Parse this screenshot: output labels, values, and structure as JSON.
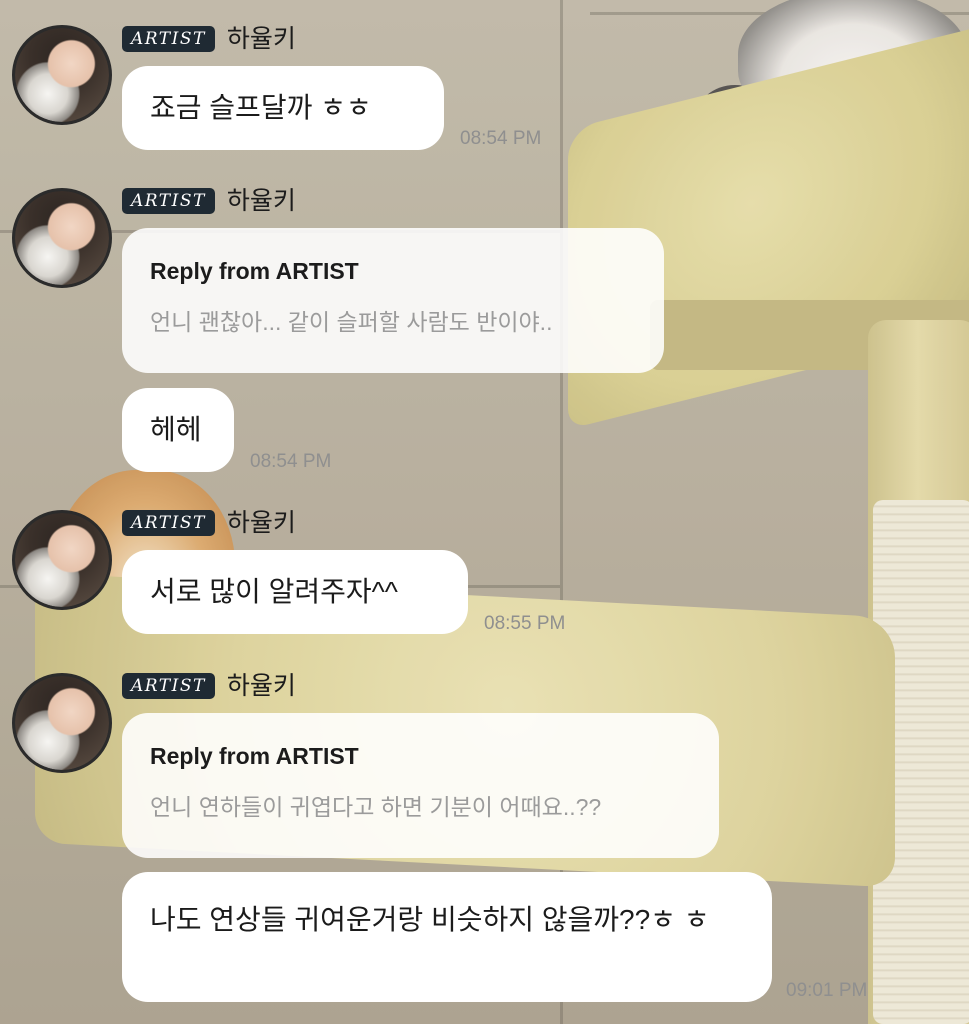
{
  "sender": {
    "badge": "ARTIST",
    "name": "하율키"
  },
  "messages": [
    {
      "kind": "text",
      "text": "죠금 슬프달까 ㅎㅎ",
      "time": "08:54 PM",
      "with_header": true
    },
    {
      "kind": "reply",
      "reply_label": "Reply from ARTIST",
      "quoted": "언니 괜찮아... 같이 슬퍼할 사람도 반이야..",
      "with_header": true
    },
    {
      "kind": "text",
      "text": "헤헤",
      "time": "08:54 PM",
      "with_header": false
    },
    {
      "kind": "text",
      "text": "서로 많이 알려주자^^",
      "time": "08:55 PM",
      "with_header": true
    },
    {
      "kind": "reply",
      "reply_label": "Reply from ARTIST",
      "quoted": "언니 연하들이 귀엽다고 하면 기분이 어때요..??",
      "with_header": true
    },
    {
      "kind": "text",
      "text": "나도 연상들 귀여운거랑 비슷하지 않을까??ㅎ ㅎ",
      "time": "09:01 PM",
      "with_header": false
    }
  ],
  "colors": {
    "bubble": "#ffffff",
    "badge_bg": "#1f2a33",
    "timestamp": "#8f8f8f",
    "quoted_text": "#9b9b9b"
  },
  "icons": [
    "profile-avatar"
  ]
}
